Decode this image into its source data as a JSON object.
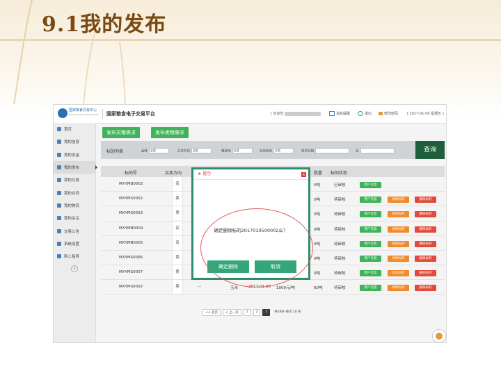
{
  "slide": {
    "title": "9.1我的发布"
  },
  "app": {
    "logo_text": "国家粮食交易中心",
    "logo_sub": "National Grain Trade Center",
    "system_title": "国家粮食电子交易平台",
    "welcome": "[ 欢迎您",
    "messages": "消息提醒",
    "logout": "退出",
    "change_password": "修改密码",
    "date": "[ 2017-01-06 星期五 ]"
  },
  "sidebar": {
    "items": [
      {
        "label": "首页",
        "icon": "home-icon"
      },
      {
        "label": "我的信息",
        "icon": "user-icon"
      },
      {
        "label": "我的资金",
        "icon": "wallet-icon"
      },
      {
        "label": "我的发布",
        "icon": "publish-icon",
        "active": true
      },
      {
        "label": "我的交易",
        "icon": "trade-icon"
      },
      {
        "label": "我的合同",
        "icon": "contract-icon"
      },
      {
        "label": "我的物流",
        "icon": "truck-icon"
      },
      {
        "label": "我的关注",
        "icon": "heart-icon"
      },
      {
        "label": "交易公告",
        "icon": "speaker-icon"
      },
      {
        "label": "系统设置",
        "icon": "gear-icon"
      },
      {
        "label": "网上指导",
        "icon": "guide-icon"
      }
    ]
  },
  "actions": {
    "publish_buy": "发布买粮需求",
    "publish_sell": "发布卖粮需求"
  },
  "filter": {
    "label": "标的列表",
    "fields": [
      {
        "name": "品种",
        "value": "全部"
      },
      {
        "name": "买卖方向",
        "value": "全部"
      },
      {
        "name": "粮源地",
        "value": "全部"
      },
      {
        "name": "标的状态",
        "value": "全部"
      },
      {
        "name": "提交日期",
        "value": ""
      },
      {
        "name": "至",
        "value": ""
      }
    ],
    "query": "查询"
  },
  "table": {
    "headers": [
      "标的号",
      "买卖方向",
      "数量",
      "标的状态"
    ],
    "rows": [
      {
        "id": "MXYMB0002",
        "dir": "买",
        "qty": "0吨",
        "status": "已审核",
        "actions": [
          "用户信息"
        ]
      },
      {
        "id": "MXYMS0002",
        "dir": "卖",
        "qty": "0吨",
        "status": "待审核",
        "actions": [
          "用户信息",
          "修改标的",
          "删除标的"
        ]
      },
      {
        "id": "MXYMS0003",
        "dir": "卖",
        "qty": "0吨",
        "status": "待审核",
        "actions": [
          "用户信息",
          "修改标的",
          "删除标的"
        ]
      },
      {
        "id": "MXYMB0004",
        "dir": "买",
        "qty": "0吨",
        "status": "待审核",
        "actions": [
          "用户信息",
          "修改标的",
          "删除标的"
        ]
      },
      {
        "id": "MXYMB0005",
        "dir": "买",
        "qty": "0吨",
        "status": "待审核",
        "actions": [
          "用户信息",
          "修改标的",
          "删除标的"
        ]
      },
      {
        "id": "MXYMS0006",
        "dir": "卖",
        "qty": "0吨",
        "status": "待审核",
        "actions": [
          "用户信息",
          "修改标的",
          "删除标的"
        ]
      },
      {
        "id": "MXYMS0007",
        "dir": "卖",
        "qty": "0吨",
        "status": "待审核",
        "actions": [
          "用户信息",
          "修改标的",
          "删除标的"
        ]
      },
      {
        "id": "MXYMS0002",
        "dir": "卖",
        "extra": "--",
        "variety": "玉米",
        "date": "2017-01-06",
        "price": "1000元/吨",
        "qty": "60吨",
        "status": "待审核",
        "actions": [
          "用户信息",
          "修改标的",
          "删除标的"
        ]
      }
    ]
  },
  "pager": {
    "first": "<< 首页",
    "prev": "< 上一页",
    "pages": [
      "1",
      "2",
      "3"
    ],
    "current": "3",
    "info": "共28条 每页 10 条"
  },
  "dialog": {
    "title": "提示",
    "close": "x",
    "message": "确定删除标的2017010500002么？",
    "confirm": "确定删除",
    "cancel": "取消"
  }
}
